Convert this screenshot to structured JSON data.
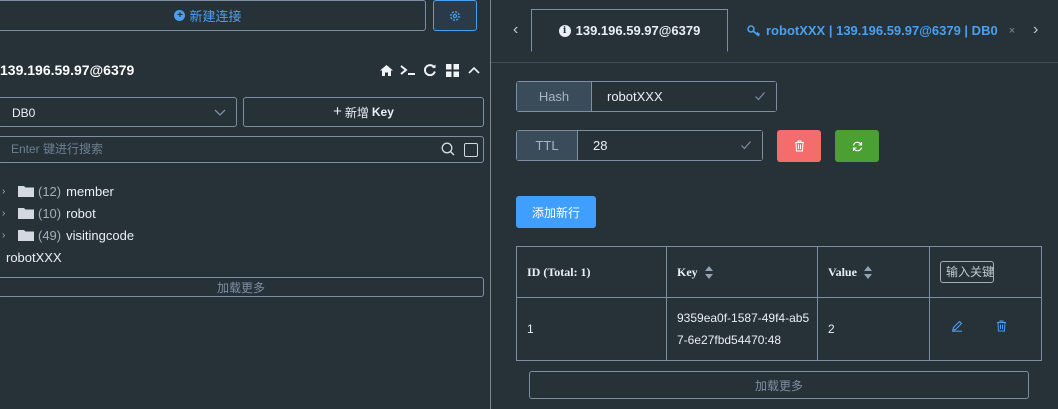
{
  "left": {
    "new_connection_label": "新建连接",
    "connection_title": "139.196.59.97@6379",
    "db_select_value": "DB0",
    "new_key_prefix": "新增",
    "new_key_suffix": "Key",
    "search_placeholder": "Enter 键进行搜索",
    "tree": [
      {
        "count": "(12)",
        "name": "member"
      },
      {
        "count": "(10)",
        "name": "robot"
      },
      {
        "count": "(49)",
        "name": "visitingcode"
      }
    ],
    "leaf_key": "robotXXX",
    "load_more": "加载更多"
  },
  "tabs": {
    "tab1_label": "139.196.59.97@6379",
    "tab2_label": "robotXXX | 139.196.59.97@6379 | DB0"
  },
  "key_detail": {
    "type_label": "Hash",
    "key_name": "robotXXX",
    "ttl_label": "TTL",
    "ttl_value": "28",
    "add_row_label": "添加新行"
  },
  "table": {
    "headers": {
      "id": "ID (Total: 1)",
      "key": "Key",
      "value": "Value",
      "filter_placeholder": "输入关键"
    },
    "rows": [
      {
        "id": "1",
        "key": "9359ea0f-1587-49f4-ab57-6e27fbd54470:48",
        "value": "2"
      }
    ],
    "load_more": "加载更多"
  },
  "colors": {
    "background": "#263238",
    "accent": "#409eff",
    "danger": "#f56c6c",
    "success": "#4aa033"
  }
}
